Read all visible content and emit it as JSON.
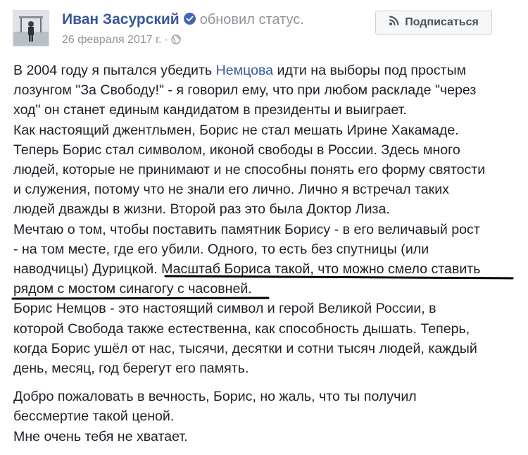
{
  "header": {
    "author": "Иван Засурский",
    "action": "обновил статус.",
    "date": "26 февраля 2017 г.",
    "separator": "·",
    "subscribe_label": "Подписаться"
  },
  "colors": {
    "link": "#365899",
    "text": "#1d2129",
    "meta": "#90949c",
    "verified": "#4267b2",
    "underline": "#000000"
  },
  "icons": [
    "verified-icon",
    "globe-icon",
    "rss-icon"
  ],
  "post": {
    "para1": {
      "line1_before": "В 2004 году я пытался убедить ",
      "line1_link": "Немцова",
      "line1_after": " идти на выборы под простым",
      "line2": "лозунгом \"За Свободу!\" - я говорил ему, что при любом раскладе \"через",
      "line3": "ход\" он станет единым кандидатом в президенты и выиграет."
    },
    "para2": {
      "line1": "Как настоящий джентльмен, Борис не стал мешать Ирине Хакамаде."
    },
    "para3": {
      "line1": "Теперь Борис стал символом, иконой свободы в России. Здесь много",
      "line2": "людей, которые не принимают и не способны понять его форму святости",
      "line3": "и служения, потому что не знали его лично. Лично я встречал таких",
      "line4": "людей дважды в жизни. Второй раз это была Доктор Лиза."
    },
    "para4": {
      "line1": "Мечтаю о том, чтобы поставить памятник Борису - в его величавый рост",
      "line2": "- на том месте, где его убили. Одного, то есть без спутницы (или",
      "line3": "наводчицы) Дурицкой. Масштаб Бориса такой, что можно смело ставить",
      "line4": "рядом с мостом синагогу с часовней."
    },
    "para5": {
      "line1": "Борис Немцов - это настоящий символ и герой Великой России, в",
      "line2": "которой Свобода также естественна, как способность дышать. Теперь,",
      "line3": "когда Борис ушёл от нас, тысячи, десятки и сотни тысяч людей, каждый",
      "line4": "день, месяц, год берегут его память."
    },
    "para6": {
      "line1": "Добро пожаловать в вечность, Борис, но жаль, что ты получил",
      "line2": "бессмертие такой ценой.",
      "line3": "Мне очень тебя не хватает."
    }
  }
}
